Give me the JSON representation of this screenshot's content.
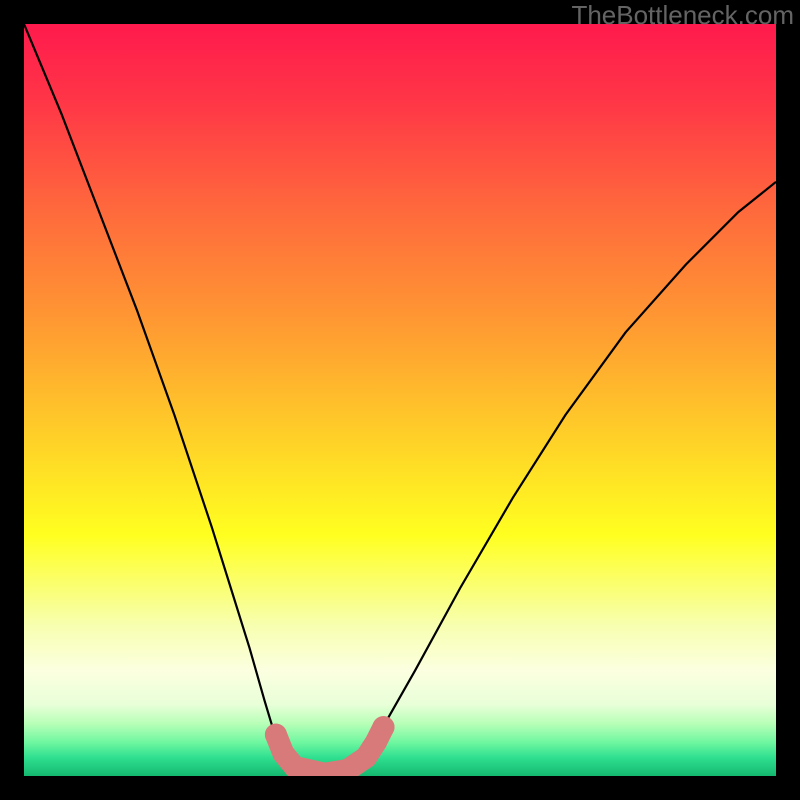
{
  "watermark": "TheBottleneck.com",
  "chart_data": {
    "type": "line",
    "title": "",
    "xlabel": "",
    "ylabel": "",
    "xlim": [
      0,
      1
    ],
    "ylim": [
      0,
      1
    ],
    "series": [
      {
        "name": "curve",
        "x": [
          0.0,
          0.05,
          0.1,
          0.15,
          0.2,
          0.25,
          0.275,
          0.3,
          0.32,
          0.335,
          0.35,
          0.37,
          0.39,
          0.41,
          0.43,
          0.45,
          0.48,
          0.52,
          0.58,
          0.65,
          0.72,
          0.8,
          0.88,
          0.95,
          1.0
        ],
        "y": [
          1.0,
          0.88,
          0.75,
          0.62,
          0.48,
          0.33,
          0.25,
          0.17,
          0.1,
          0.05,
          0.02,
          0.005,
          0.0,
          0.0,
          0.005,
          0.02,
          0.07,
          0.14,
          0.25,
          0.37,
          0.48,
          0.59,
          0.68,
          0.75,
          0.79
        ]
      }
    ],
    "markers": {
      "comment": "rounded markers drawn near the valley floor",
      "points": [
        {
          "x": 0.335,
          "y": 0.055
        },
        {
          "x": 0.345,
          "y": 0.03
        },
        {
          "x": 0.36,
          "y": 0.012
        },
        {
          "x": 0.4,
          "y": 0.003
        },
        {
          "x": 0.43,
          "y": 0.008
        },
        {
          "x": 0.455,
          "y": 0.025
        },
        {
          "x": 0.468,
          "y": 0.045
        },
        {
          "x": 0.478,
          "y": 0.065
        }
      ],
      "color": "#d97a7a"
    },
    "gradient_stops": [
      {
        "offset": 0.0,
        "color": "#ff1a4d"
      },
      {
        "offset": 0.1,
        "color": "#ff3547"
      },
      {
        "offset": 0.25,
        "color": "#ff6a3c"
      },
      {
        "offset": 0.4,
        "color": "#ff9a32"
      },
      {
        "offset": 0.55,
        "color": "#ffd028"
      },
      {
        "offset": 0.68,
        "color": "#ffff20"
      },
      {
        "offset": 0.8,
        "color": "#f7ffb0"
      },
      {
        "offset": 0.86,
        "color": "#fcffe0"
      },
      {
        "offset": 0.905,
        "color": "#e8ffd8"
      },
      {
        "offset": 0.93,
        "color": "#b8ffb8"
      },
      {
        "offset": 0.955,
        "color": "#70f7a0"
      },
      {
        "offset": 0.975,
        "color": "#30e090"
      },
      {
        "offset": 1.0,
        "color": "#14b870"
      }
    ]
  }
}
